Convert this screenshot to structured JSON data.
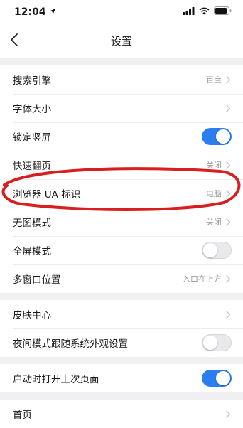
{
  "status": {
    "time": "12:04"
  },
  "nav": {
    "title": "设置"
  },
  "sections": [
    [
      {
        "label": "搜索引擎",
        "value": "百度",
        "type": "chevron"
      },
      {
        "label": "字体大小",
        "value": "",
        "type": "chevron"
      },
      {
        "label": "锁定竖屏",
        "type": "toggle",
        "on": true
      },
      {
        "label": "快速翻页",
        "value": "关闭",
        "type": "chevron"
      },
      {
        "label": "浏览器 UA 标识",
        "value": "电脑",
        "type": "chevron"
      },
      {
        "label": "无图模式",
        "value": "关闭",
        "type": "chevron"
      },
      {
        "label": "全屏模式",
        "type": "toggle",
        "on": false
      },
      {
        "label": "多窗口位置",
        "value": "入口在上方",
        "type": "chevron"
      }
    ],
    [
      {
        "label": "皮肤中心",
        "value": "",
        "type": "chevron"
      },
      {
        "label": "夜间模式跟随系统外观设置",
        "type": "toggle",
        "on": false
      }
    ],
    [
      {
        "label": "启动时打开上次页面",
        "type": "toggle",
        "on": true
      }
    ],
    [
      {
        "label": "首页",
        "value": "",
        "type": "chevron"
      }
    ]
  ],
  "colors": {
    "accent": "#2c7ef0",
    "annotation": "#d81e1e"
  }
}
